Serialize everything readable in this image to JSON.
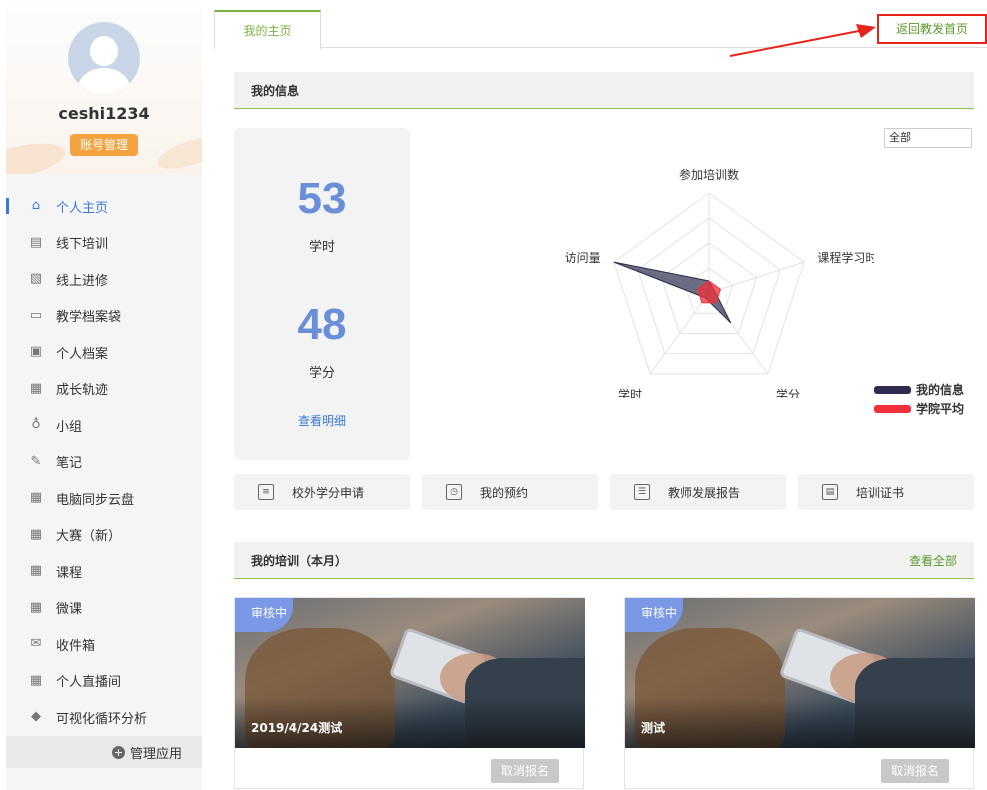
{
  "sidebar": {
    "username": "ceshi1234",
    "account_button": "账号管理",
    "items": [
      {
        "label": "个人主页",
        "icon": "home-icon",
        "active": true
      },
      {
        "label": "线下培训",
        "icon": "book-icon"
      },
      {
        "label": "线上进修",
        "icon": "chart-icon"
      },
      {
        "label": "教学档案袋",
        "icon": "folder-icon"
      },
      {
        "label": "个人档案",
        "icon": "profile-card-icon"
      },
      {
        "label": "成长轨迹",
        "icon": "app-icon"
      },
      {
        "label": "小组",
        "icon": "group-icon"
      },
      {
        "label": "笔记",
        "icon": "note-icon"
      },
      {
        "label": "电脑同步云盘",
        "icon": "app-icon"
      },
      {
        "label": "大赛（新）",
        "icon": "app-icon"
      },
      {
        "label": "课程",
        "icon": "app-icon"
      },
      {
        "label": "微课",
        "icon": "app-icon"
      },
      {
        "label": "收件箱",
        "icon": "inbox-icon"
      },
      {
        "label": "个人直播间",
        "icon": "app-icon"
      },
      {
        "label": "可视化循环分析",
        "icon": "diamond-icon"
      }
    ],
    "manage_apps": "管理应用"
  },
  "tabs": {
    "home": "我的主页",
    "return_home": "返回教发首页"
  },
  "info": {
    "header": "我的信息",
    "hours_value": "53",
    "hours_label": "学时",
    "credits_value": "48",
    "credits_label": "学分",
    "detail_link": "查看明细",
    "filter_value": "全部"
  },
  "chart_data": {
    "type": "radar",
    "axes": [
      "参加培训数",
      "课程学习时长",
      "学分",
      "学时",
      "访问量"
    ],
    "scale_max": 1,
    "series": [
      {
        "name": "我的信息",
        "color": "#2e2d4d",
        "values": [
          0.12,
          0.06,
          0.37,
          0.06,
          1.0
        ]
      },
      {
        "name": "学院平均",
        "color": "#f0303a",
        "values": [
          0.12,
          0.12,
          0.12,
          0.12,
          0.12
        ]
      }
    ],
    "grid_levels": 4,
    "legend_position": "bottom-right"
  },
  "quick_actions": [
    {
      "label": "校外学分申请",
      "icon": "form-icon"
    },
    {
      "label": "我的预约",
      "icon": "clock-icon"
    },
    {
      "label": "教师发展报告",
      "icon": "clipboard-icon"
    },
    {
      "label": "培训证书",
      "icon": "certificate-icon"
    }
  ],
  "training": {
    "header": "我的培训（本月）",
    "view_all": "查看全部",
    "cards": [
      {
        "status": "审核中",
        "title": "2019/4/24测试",
        "button": "取消报名"
      },
      {
        "status": "审核中",
        "title": "测试",
        "button": "取消报名"
      }
    ]
  },
  "colors": {
    "accent_green": "#7cb342",
    "link_blue": "#3a78d8",
    "stat_blue": "#6a8fd8",
    "account_orange": "#f5a340",
    "highlight_red": "#e8231c"
  }
}
